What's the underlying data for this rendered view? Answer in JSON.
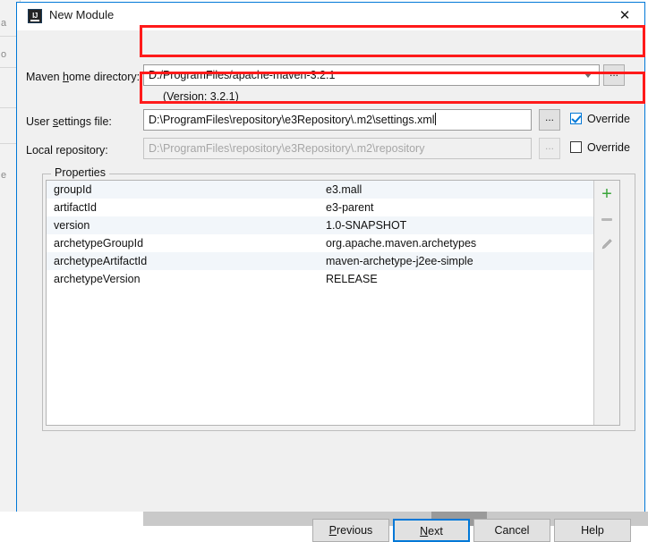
{
  "window": {
    "title": "New Module",
    "app_icon": "intellij-idea-icon",
    "close_label": "✕",
    "accent_color": "#0078d7"
  },
  "backdrop": {
    "fragments": [
      "a",
      "o",
      "e"
    ]
  },
  "form": {
    "maven_home": {
      "label_pre": "Maven ",
      "label_mnem": "h",
      "label_post": "ome directory:",
      "value": "D:/ProgramFiles/apache-maven-3.2.1",
      "browse_label": "...",
      "dropdown_icon": "chevron-down-icon"
    },
    "version_hint": "(Version: 3.2.1)",
    "user_settings": {
      "label_pre": "User ",
      "label_mnem": "s",
      "label_post": "ettings file:",
      "value": "D:\\ProgramFiles\\repository\\e3Repository\\.m2\\settings.xml",
      "browse_label": "...",
      "override_label": "Override",
      "override_checked": true
    },
    "local_repository": {
      "label": "Local repository:",
      "value": "D:\\ProgramFiles\\repository\\e3Repository\\.m2\\repository",
      "browse_label": "...",
      "override_label": "Override",
      "override_checked": false
    }
  },
  "properties": {
    "legend": "Properties",
    "toolbar": {
      "add_label": "+",
      "remove_icon": "minus-icon",
      "edit_icon": "pencil-icon"
    },
    "rows": [
      {
        "key": "groupId",
        "value": "e3.mall"
      },
      {
        "key": "artifactId",
        "value": "e3-parent"
      },
      {
        "key": "version",
        "value": "1.0-SNAPSHOT"
      },
      {
        "key": "archetypeGroupId",
        "value": "org.apache.maven.archetypes"
      },
      {
        "key": "archetypeArtifactId",
        "value": "maven-archetype-j2ee-simple"
      },
      {
        "key": "archetypeVersion",
        "value": "RELEASE"
      }
    ]
  },
  "buttons": {
    "previous": {
      "pre": "",
      "mnem": "P",
      "post": "revious"
    },
    "next": {
      "pre": "",
      "mnem": "N",
      "post": "ext"
    },
    "cancel": {
      "label": "Cancel"
    },
    "help": {
      "label": "Help"
    }
  },
  "annotations": {
    "color": "#ff1a1a",
    "boxes": [
      "maven-home-field-highlight",
      "user-settings-row-highlight"
    ]
  }
}
